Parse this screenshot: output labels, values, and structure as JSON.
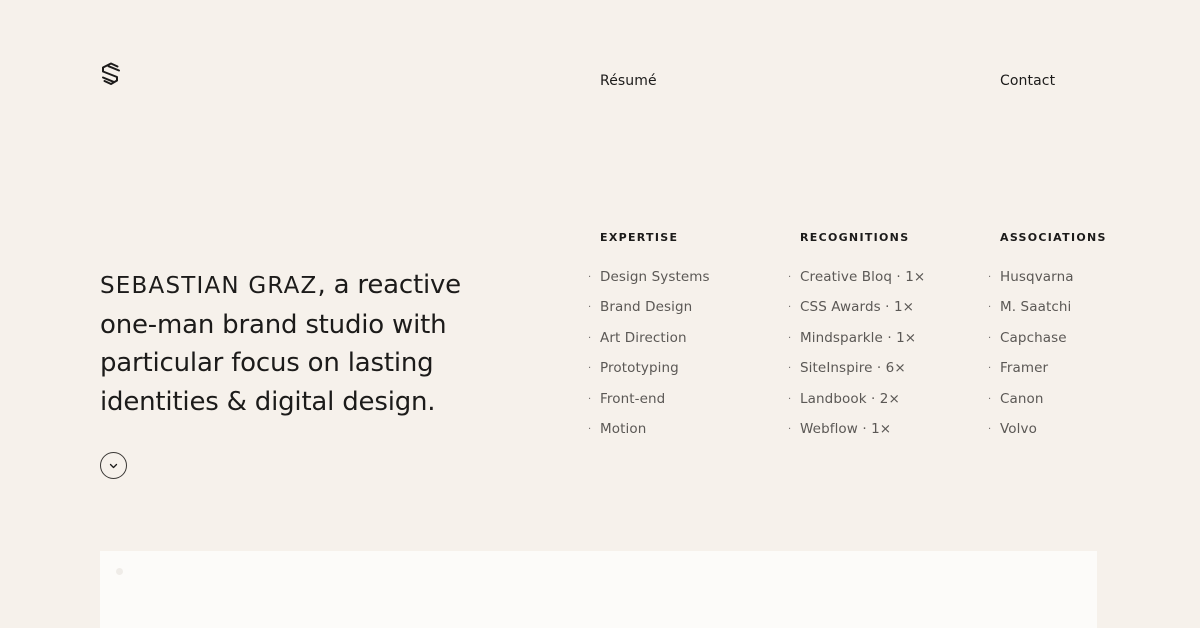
{
  "header": {
    "logo_icon": "s-monogram-icon",
    "nav": [
      {
        "label": "Résumé"
      },
      {
        "label": "Contact"
      }
    ]
  },
  "intro": {
    "name": "Sebastian Graz",
    "text": ", a reactive one-man brand studio with particular focus on lasting identities & digital design."
  },
  "scroll_button": {
    "icon": "chevron-down-icon"
  },
  "columns": [
    {
      "heading": "Expertise",
      "items": [
        "Design Systems",
        "Brand Design",
        "Art Direction",
        "Prototyping",
        "Front-end",
        "Motion"
      ]
    },
    {
      "heading": "Recognitions",
      "items": [
        "Creative Bloq · 1×",
        "CSS Awards · 1×",
        "Mindsparkle · 1×",
        "SiteInspire · 6×",
        "Landbook · 2×",
        "Webflow · 1×"
      ]
    },
    {
      "heading": "Associations",
      "items": [
        "Husqvarna",
        "M. Saatchi",
        "Capchase",
        "Framer",
        "Canon",
        "Volvo"
      ]
    }
  ],
  "colors": {
    "background": "#f6f1eb",
    "text": "#1c1b1a",
    "muted_text": "#5b5855",
    "panel": "#fcfbf9"
  }
}
